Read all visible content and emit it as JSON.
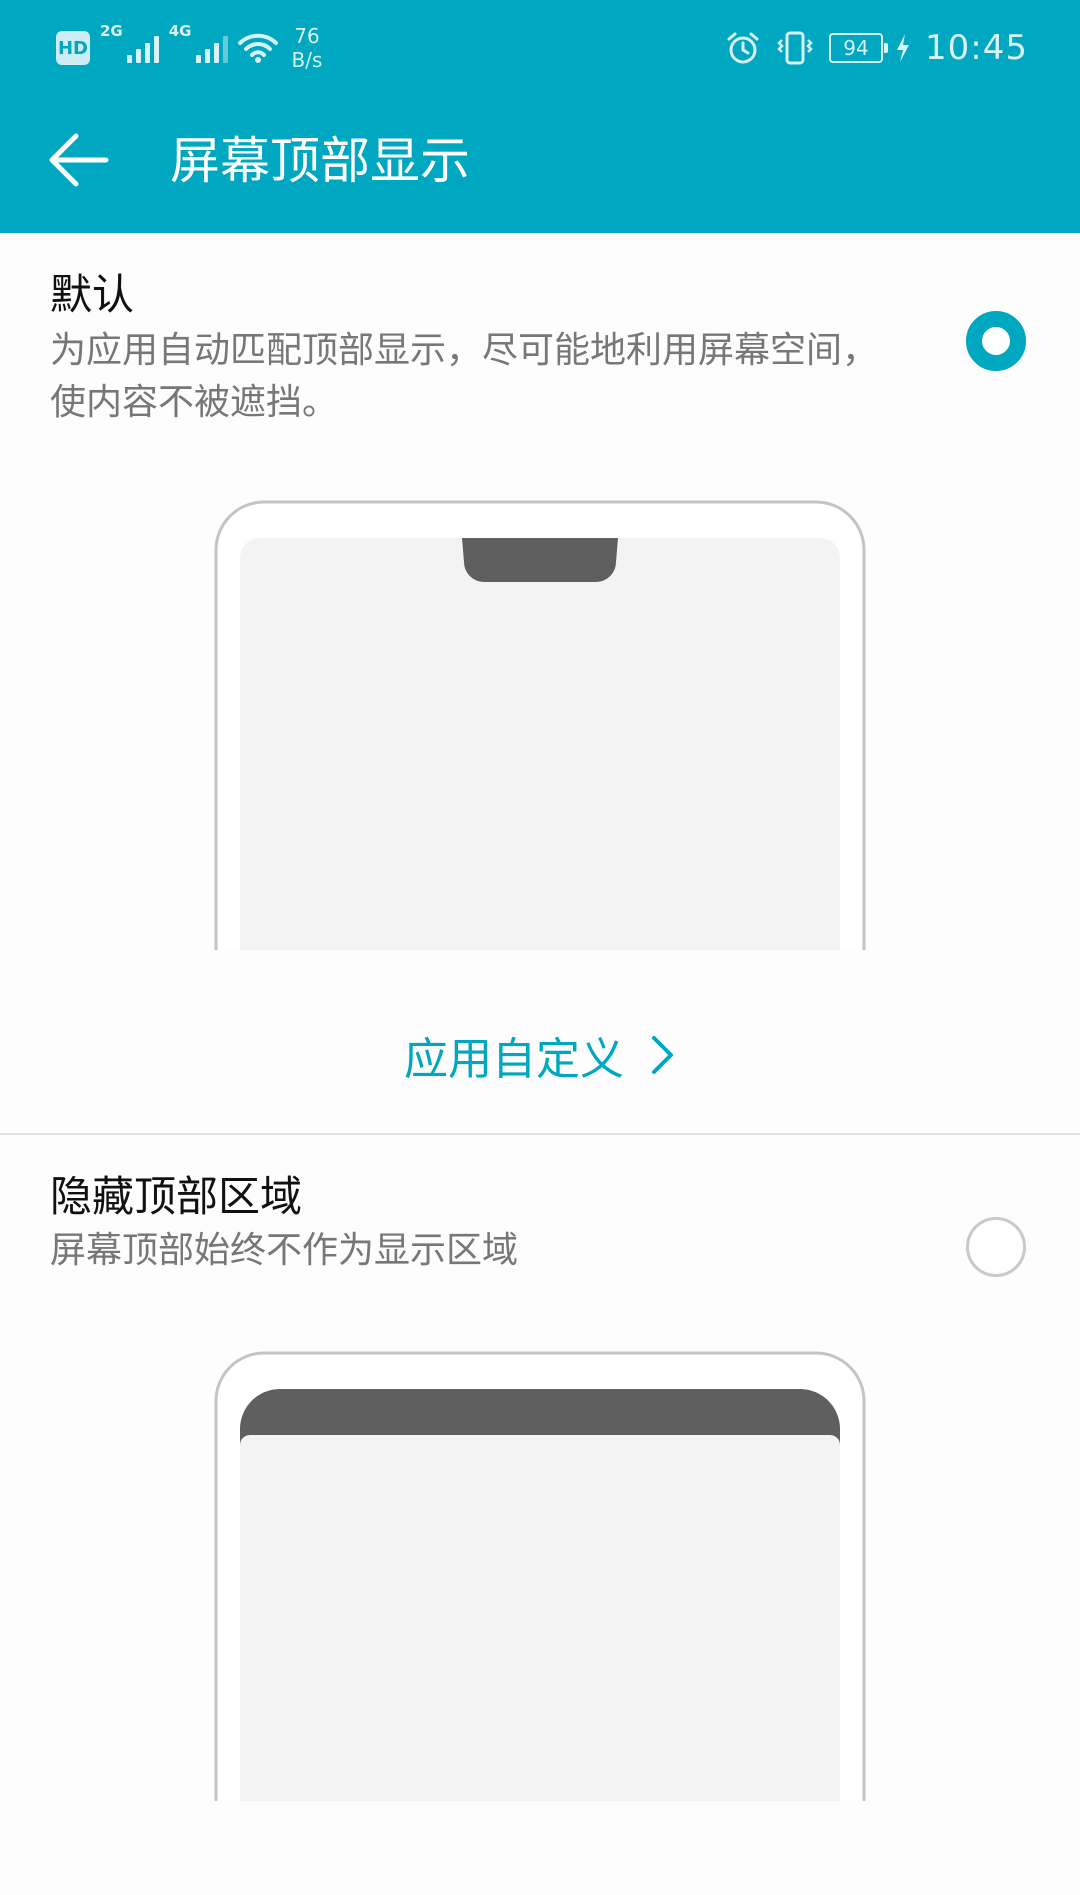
{
  "status_bar": {
    "hd": "HD",
    "sim1_gen": "2G",
    "sim2_gen": "4G",
    "speed_value": "76",
    "speed_unit": "B/s",
    "battery": "94",
    "time": "10:45",
    "icons": [
      "hd-icon",
      "signal-icon",
      "signal-icon",
      "wifi-icon",
      "alarm-icon",
      "vibrate-icon",
      "battery-icon",
      "charging-icon"
    ]
  },
  "toolbar": {
    "back_icon": "arrow-left-icon",
    "title": "屏幕顶部显示"
  },
  "options": [
    {
      "title": "默认",
      "description": "为应用自动匹配顶部显示，尽可能地利用屏幕空间，使内容不被遮挡。",
      "selected": true
    },
    {
      "title": "隐藏顶部区域",
      "description": "屏幕顶部始终不作为显示区域",
      "selected": false
    }
  ],
  "custom_link": {
    "label": "应用自定义",
    "icon": "chevron-right-icon"
  },
  "colors": {
    "accent": "#00a7c0",
    "notch_dark": "#5f5f5f",
    "screen_fill": "#f3f3f3",
    "frame": "#c4c4c4"
  }
}
